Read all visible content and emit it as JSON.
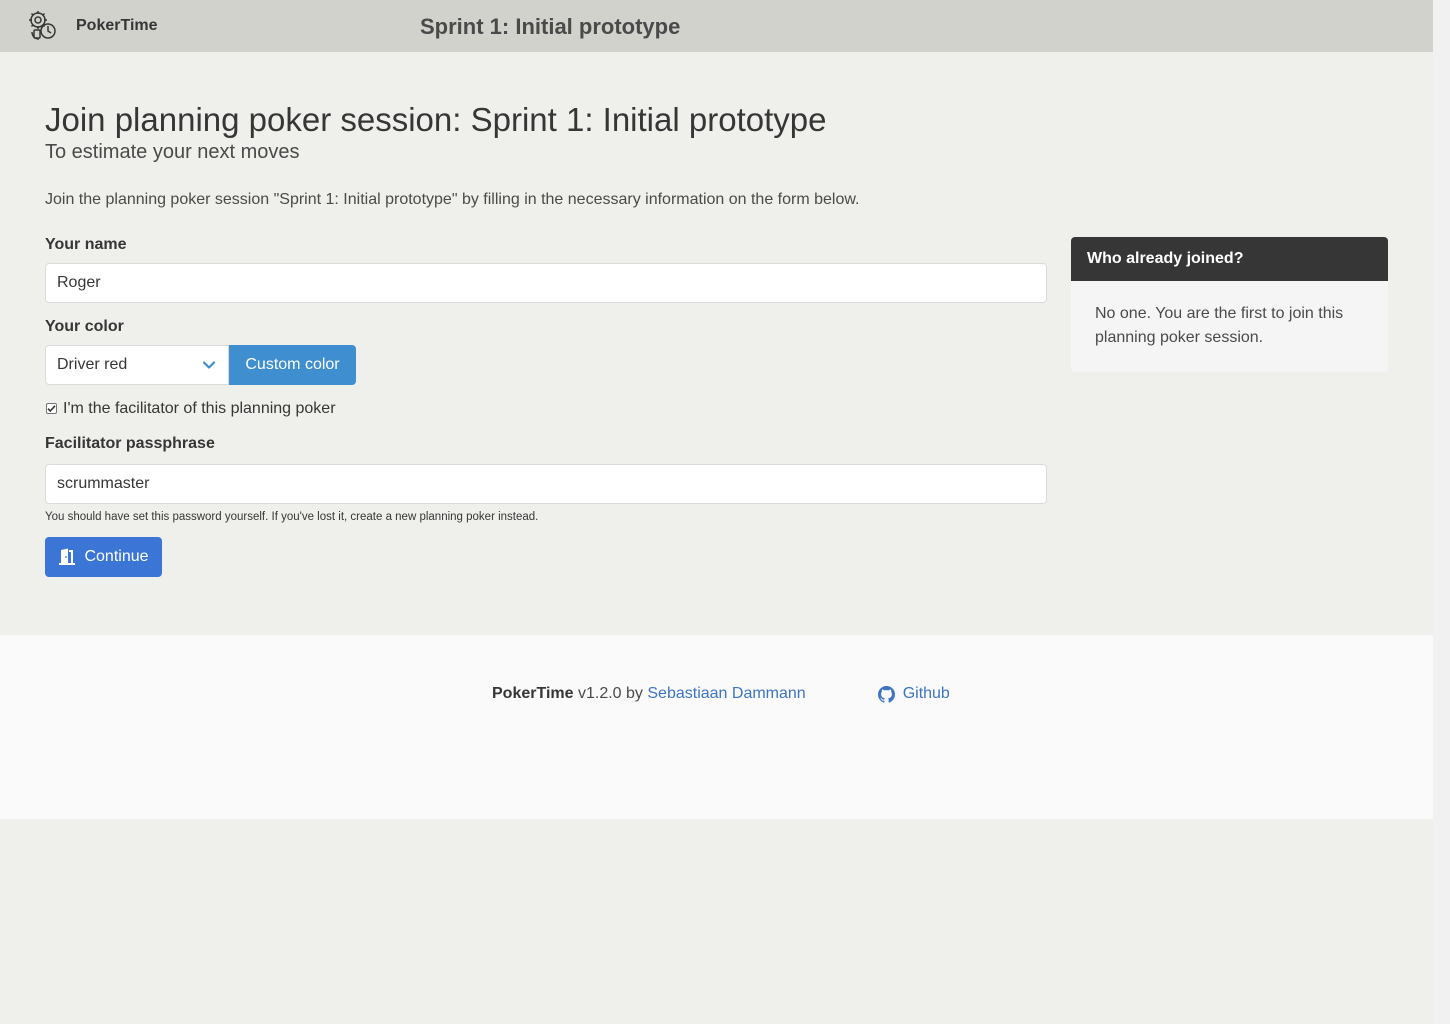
{
  "navbar": {
    "brand_name": "PokerTime",
    "session_title": "Sprint 1: Initial prototype"
  },
  "main": {
    "title": "Join planning poker session: Sprint 1: Initial prototype",
    "subtitle": "To estimate your next moves",
    "intro": "Join the planning poker session \"Sprint 1: Initial prototype\" by filling in the necessary information on the form below.",
    "name_label": "Your name",
    "name_value": "Roger",
    "color_label": "Your color",
    "color_value": "Driver red",
    "custom_color_label": "Custom color",
    "facilitator_label": "I'm the facilitator of this planning poker",
    "facilitator_checked": true,
    "passphrase_label": "Facilitator passphrase",
    "passphrase_value": "scrummaster",
    "passphrase_help": "You should have set this password yourself. If you've lost it, create a new planning poker instead.",
    "continue_label": "Continue"
  },
  "sidebar": {
    "heading": "Who already joined?",
    "body": "No one. You are the first to join this planning poker session."
  },
  "footer": {
    "app_name": "PokerTime",
    "version": "v1.2.0 by",
    "author": "Sebastiaan Dammann",
    "github_label": "Github"
  },
  "colors": {
    "navbar_bg": "#d2d2cd",
    "page_bg": "#efefeb",
    "custom_color_button": "#3e8ed0",
    "continue_button": "#3b75d6",
    "panel_heading": "#363636",
    "link": "#3e74c4"
  },
  "icons": {
    "brand": "poker-chips-icon",
    "select_arrow": "chevron-down-icon",
    "continue": "door-enter-icon",
    "github": "github-icon"
  }
}
